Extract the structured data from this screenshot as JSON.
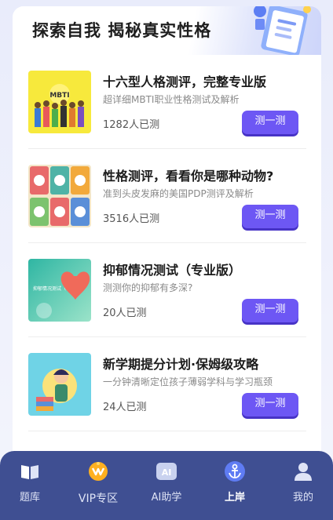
{
  "banner": {
    "title": "探索自我 揭秘真实性格"
  },
  "tests": [
    {
      "title": "十六型人格测评，完整专业版",
      "desc": "超详细MBTI职业性格测试及解析",
      "count": "1282人已测",
      "button": "测一测",
      "thumb_text": "MBTI"
    },
    {
      "title": "性格测评，看看你是哪种动物?",
      "desc": "准到头皮发麻的美国PDP测评及解析",
      "count": "3516人已测",
      "button": "测一测"
    },
    {
      "title": "抑郁情况测试（专业版）",
      "desc": "测测你的抑郁有多深?",
      "count": "20人已测",
      "button": "测一测",
      "thumb_text": "抑郁情况测试（专业版）"
    },
    {
      "title": "新学期提分计划·保姆级攻略",
      "desc": "一分钟清晰定位孩子薄弱学科与学习瓶颈",
      "count": "24人已测",
      "button": "测一测"
    }
  ],
  "tabbar": {
    "items": [
      {
        "label": "题库",
        "icon": "book-icon"
      },
      {
        "label": "VIP专区",
        "icon": "vip-crown-icon"
      },
      {
        "label": "AI助学",
        "icon": "ai-icon"
      },
      {
        "label": "上岸",
        "icon": "anchor-icon",
        "active": true
      },
      {
        "label": "我的",
        "icon": "profile-icon"
      }
    ]
  },
  "colors": {
    "accent": "#6d57f4",
    "tabbar": "#30428a"
  }
}
